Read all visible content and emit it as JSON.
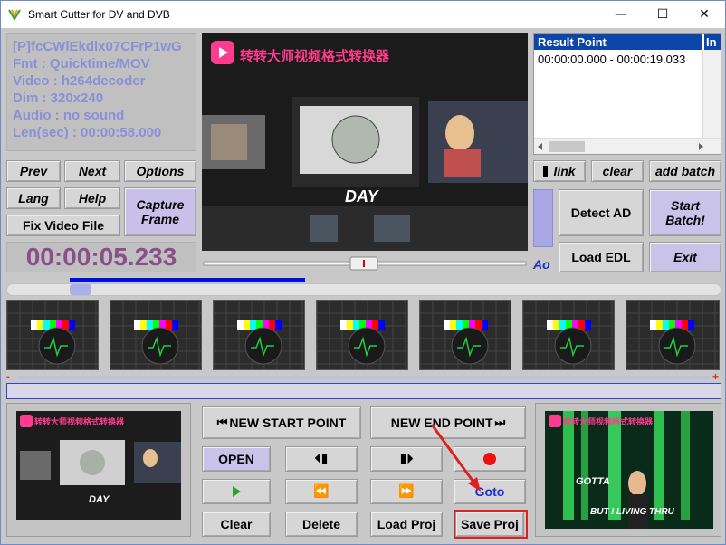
{
  "window": {
    "title": "Smart Cutter for DV and DVB",
    "minimize": "—",
    "maximize": "☐",
    "close": "✕"
  },
  "file_info": {
    "name": "[P]fcCWlEkdlx07CFrP1wG",
    "fmt": "Fmt : Quicktime/MOV",
    "video": "Video : h264decoder",
    "dim": "Dim : 320x240",
    "audio": "Audio : no sound",
    "len": "Len(sec) : 00:00:58.000"
  },
  "nav_buttons": {
    "prev": "Prev",
    "next": "Next",
    "options": "Options",
    "lang": "Lang",
    "help": "Help",
    "capture_frame": "Capture Frame",
    "fix_video_file": "Fix Video File"
  },
  "current_time": "00:00:05.233",
  "result_panel": {
    "columns": [
      "Result Point",
      "In"
    ],
    "rows": [
      "00:00:00.000 - 00:00:19.033"
    ]
  },
  "right_buttons": {
    "link": "link",
    "clear": "clear",
    "add_batch": "add batch",
    "detect_ad": "Detect AD",
    "start_batch": "Start Batch!",
    "load_edl": "Load EDL",
    "exit": "Exit",
    "ao": "Ao"
  },
  "video_overlay": {
    "watermark": "转转大师视频格式转换器",
    "caption": "DAY",
    "right_caption_top": "GOTTA",
    "right_caption_bottom": "BUT I LIVING THRU"
  },
  "thumbnails": {
    "count": 7
  },
  "bottom_buttons": {
    "new_start_point": "NEW START POINT",
    "new_end_point": "NEW END POINT",
    "open": "OPEN",
    "goto": "Goto",
    "clear": "Clear",
    "delete": "Delete",
    "load_proj": "Load Proj",
    "save_proj": "Save Proj"
  },
  "seek": {
    "minus": "-",
    "plus": "+"
  },
  "colors": {
    "accent_blue": "#0010e0",
    "time_color": "#8a4f8a",
    "info_color": "#8b8fd6",
    "highlight_red": "#e02020"
  }
}
